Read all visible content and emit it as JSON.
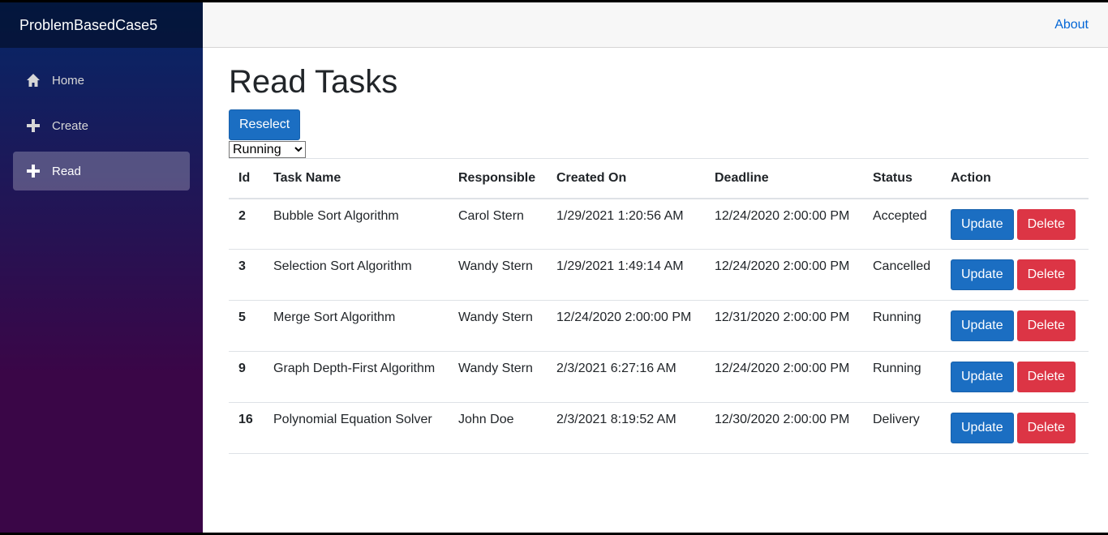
{
  "brand": "ProblemBasedCase5",
  "nav": [
    {
      "label": "Home",
      "icon": "home-icon"
    },
    {
      "label": "Create",
      "icon": "plus-icon"
    },
    {
      "label": "Read",
      "icon": "plus-icon",
      "active": true
    }
  ],
  "topbar": {
    "about": "About"
  },
  "page": {
    "title": "Read Tasks",
    "reselect": "Reselect",
    "filter_value": "Running"
  },
  "table": {
    "headers": [
      "Id",
      "Task Name",
      "Responsible",
      "Created On",
      "Deadline",
      "Status",
      "Action"
    ],
    "rows": [
      {
        "id": "2",
        "name": "Bubble Sort Algorithm",
        "responsible": "Carol Stern",
        "created": "1/29/2021 1:20:56 AM",
        "deadline": "12/24/2020 2:00:00 PM",
        "status": "Accepted"
      },
      {
        "id": "3",
        "name": "Selection Sort Algorithm",
        "responsible": "Wandy Stern",
        "created": "1/29/2021 1:49:14 AM",
        "deadline": "12/24/2020 2:00:00 PM",
        "status": "Cancelled"
      },
      {
        "id": "5",
        "name": "Merge Sort Algorithm",
        "responsible": "Wandy Stern",
        "created": "12/24/2020 2:00:00 PM",
        "deadline": "12/31/2020 2:00:00 PM",
        "status": "Running"
      },
      {
        "id": "9",
        "name": "Graph Depth-First Algorithm",
        "responsible": "Wandy Stern",
        "created": "2/3/2021 6:27:16 AM",
        "deadline": "12/24/2020 2:00:00 PM",
        "status": "Running"
      },
      {
        "id": "16",
        "name": "Polynomial Equation Solver",
        "responsible": "John Doe",
        "created": "2/3/2021 8:19:52 AM",
        "deadline": "12/30/2020 2:00:00 PM",
        "status": "Delivery"
      }
    ],
    "update_label": "Update",
    "delete_label": "Delete"
  },
  "colors": {
    "primary": "#1b6ec2",
    "danger": "#dc3545",
    "link": "#0366d6"
  }
}
